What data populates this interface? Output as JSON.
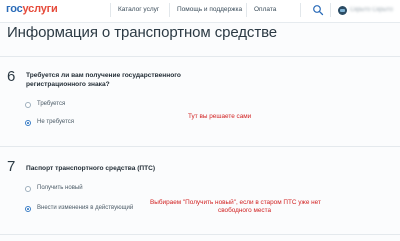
{
  "header": {
    "logo_part1": "гос",
    "logo_part2": "услуги",
    "nav": [
      {
        "label": "Каталог услуг"
      },
      {
        "label": "Помощь и поддержка"
      },
      {
        "label": "Оплата"
      }
    ],
    "user_name": "Скрыто Скрыто"
  },
  "page": {
    "title": "Информация о транспортном средстве"
  },
  "questions": [
    {
      "number": "6",
      "text_line1": "Требуется ли вам получение государственного",
      "text_line2": "регистрационного знака?",
      "options": [
        {
          "label": "Требуется",
          "checked": false
        },
        {
          "label": "Не требуется",
          "checked": true
        }
      ],
      "annotation": "Тут вы решаете сами"
    },
    {
      "number": "7",
      "text_line1": "Паспорт транспортного средства (ПТС)",
      "options": [
        {
          "label": "Получить новый",
          "checked": false
        },
        {
          "label": "Внести изменения в действующий",
          "checked": true
        }
      ],
      "annotation_line1": "Выбираем \"Получить новый\", если в старом ПТС уже нет",
      "annotation_line2": "свободного места"
    }
  ],
  "colors": {
    "brand_blue": "#2a6bb8",
    "brand_red": "#e64b3b",
    "annotation_red": "#d11f1f",
    "radio_accent": "#3b7ec6"
  }
}
